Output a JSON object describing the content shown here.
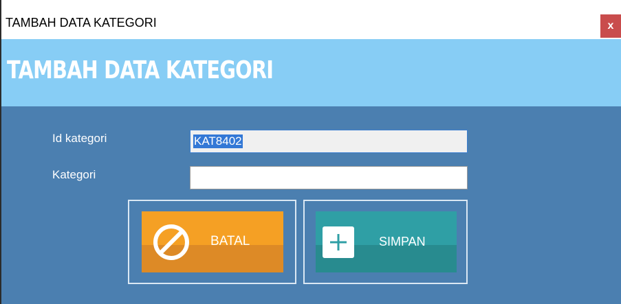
{
  "window": {
    "title": "TAMBAH DATA KATEGORI",
    "close_label": "x"
  },
  "header": {
    "heading": "TAMBAH DATA KATEGORI"
  },
  "form": {
    "id_label": "Id kategori",
    "id_value": "KAT8402",
    "kategori_label": "Kategori",
    "kategori_value": ""
  },
  "buttons": {
    "batal_label": "BATAL",
    "batal_icon": "cancel-circle-icon",
    "simpan_label": "SIMPAN",
    "simpan_icon": "plus-icon"
  },
  "colors": {
    "header": "#87cdf5",
    "body": "#4b7fb0",
    "batal": "#f5a024",
    "simpan": "#2f9fa5",
    "close": "#c94c4c"
  }
}
